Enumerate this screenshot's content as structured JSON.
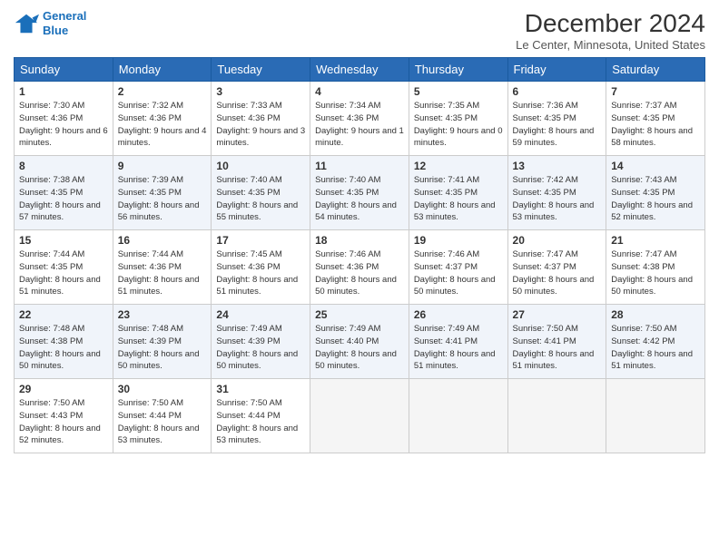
{
  "header": {
    "logo_line1": "General",
    "logo_line2": "Blue",
    "month": "December 2024",
    "location": "Le Center, Minnesota, United States"
  },
  "weekdays": [
    "Sunday",
    "Monday",
    "Tuesday",
    "Wednesday",
    "Thursday",
    "Friday",
    "Saturday"
  ],
  "weeks": [
    [
      {
        "day": 1,
        "sunrise": "7:30 AM",
        "sunset": "4:36 PM",
        "daylight": "9 hours and 6 minutes."
      },
      {
        "day": 2,
        "sunrise": "7:32 AM",
        "sunset": "4:36 PM",
        "daylight": "9 hours and 4 minutes."
      },
      {
        "day": 3,
        "sunrise": "7:33 AM",
        "sunset": "4:36 PM",
        "daylight": "9 hours and 3 minutes."
      },
      {
        "day": 4,
        "sunrise": "7:34 AM",
        "sunset": "4:36 PM",
        "daylight": "9 hours and 1 minute."
      },
      {
        "day": 5,
        "sunrise": "7:35 AM",
        "sunset": "4:35 PM",
        "daylight": "9 hours and 0 minutes."
      },
      {
        "day": 6,
        "sunrise": "7:36 AM",
        "sunset": "4:35 PM",
        "daylight": "8 hours and 59 minutes."
      },
      {
        "day": 7,
        "sunrise": "7:37 AM",
        "sunset": "4:35 PM",
        "daylight": "8 hours and 58 minutes."
      }
    ],
    [
      {
        "day": 8,
        "sunrise": "7:38 AM",
        "sunset": "4:35 PM",
        "daylight": "8 hours and 57 minutes."
      },
      {
        "day": 9,
        "sunrise": "7:39 AM",
        "sunset": "4:35 PM",
        "daylight": "8 hours and 56 minutes."
      },
      {
        "day": 10,
        "sunrise": "7:40 AM",
        "sunset": "4:35 PM",
        "daylight": "8 hours and 55 minutes."
      },
      {
        "day": 11,
        "sunrise": "7:40 AM",
        "sunset": "4:35 PM",
        "daylight": "8 hours and 54 minutes."
      },
      {
        "day": 12,
        "sunrise": "7:41 AM",
        "sunset": "4:35 PM",
        "daylight": "8 hours and 53 minutes."
      },
      {
        "day": 13,
        "sunrise": "7:42 AM",
        "sunset": "4:35 PM",
        "daylight": "8 hours and 53 minutes."
      },
      {
        "day": 14,
        "sunrise": "7:43 AM",
        "sunset": "4:35 PM",
        "daylight": "8 hours and 52 minutes."
      }
    ],
    [
      {
        "day": 15,
        "sunrise": "7:44 AM",
        "sunset": "4:35 PM",
        "daylight": "8 hours and 51 minutes."
      },
      {
        "day": 16,
        "sunrise": "7:44 AM",
        "sunset": "4:36 PM",
        "daylight": "8 hours and 51 minutes."
      },
      {
        "day": 17,
        "sunrise": "7:45 AM",
        "sunset": "4:36 PM",
        "daylight": "8 hours and 51 minutes."
      },
      {
        "day": 18,
        "sunrise": "7:46 AM",
        "sunset": "4:36 PM",
        "daylight": "8 hours and 50 minutes."
      },
      {
        "day": 19,
        "sunrise": "7:46 AM",
        "sunset": "4:37 PM",
        "daylight": "8 hours and 50 minutes."
      },
      {
        "day": 20,
        "sunrise": "7:47 AM",
        "sunset": "4:37 PM",
        "daylight": "8 hours and 50 minutes."
      },
      {
        "day": 21,
        "sunrise": "7:47 AM",
        "sunset": "4:38 PM",
        "daylight": "8 hours and 50 minutes."
      }
    ],
    [
      {
        "day": 22,
        "sunrise": "7:48 AM",
        "sunset": "4:38 PM",
        "daylight": "8 hours and 50 minutes."
      },
      {
        "day": 23,
        "sunrise": "7:48 AM",
        "sunset": "4:39 PM",
        "daylight": "8 hours and 50 minutes."
      },
      {
        "day": 24,
        "sunrise": "7:49 AM",
        "sunset": "4:39 PM",
        "daylight": "8 hours and 50 minutes."
      },
      {
        "day": 25,
        "sunrise": "7:49 AM",
        "sunset": "4:40 PM",
        "daylight": "8 hours and 50 minutes."
      },
      {
        "day": 26,
        "sunrise": "7:49 AM",
        "sunset": "4:41 PM",
        "daylight": "8 hours and 51 minutes."
      },
      {
        "day": 27,
        "sunrise": "7:50 AM",
        "sunset": "4:41 PM",
        "daylight": "8 hours and 51 minutes."
      },
      {
        "day": 28,
        "sunrise": "7:50 AM",
        "sunset": "4:42 PM",
        "daylight": "8 hours and 51 minutes."
      }
    ],
    [
      {
        "day": 29,
        "sunrise": "7:50 AM",
        "sunset": "4:43 PM",
        "daylight": "8 hours and 52 minutes."
      },
      {
        "day": 30,
        "sunrise": "7:50 AM",
        "sunset": "4:44 PM",
        "daylight": "8 hours and 53 minutes."
      },
      {
        "day": 31,
        "sunrise": "7:50 AM",
        "sunset": "4:44 PM",
        "daylight": "8 hours and 53 minutes."
      },
      null,
      null,
      null,
      null
    ]
  ]
}
